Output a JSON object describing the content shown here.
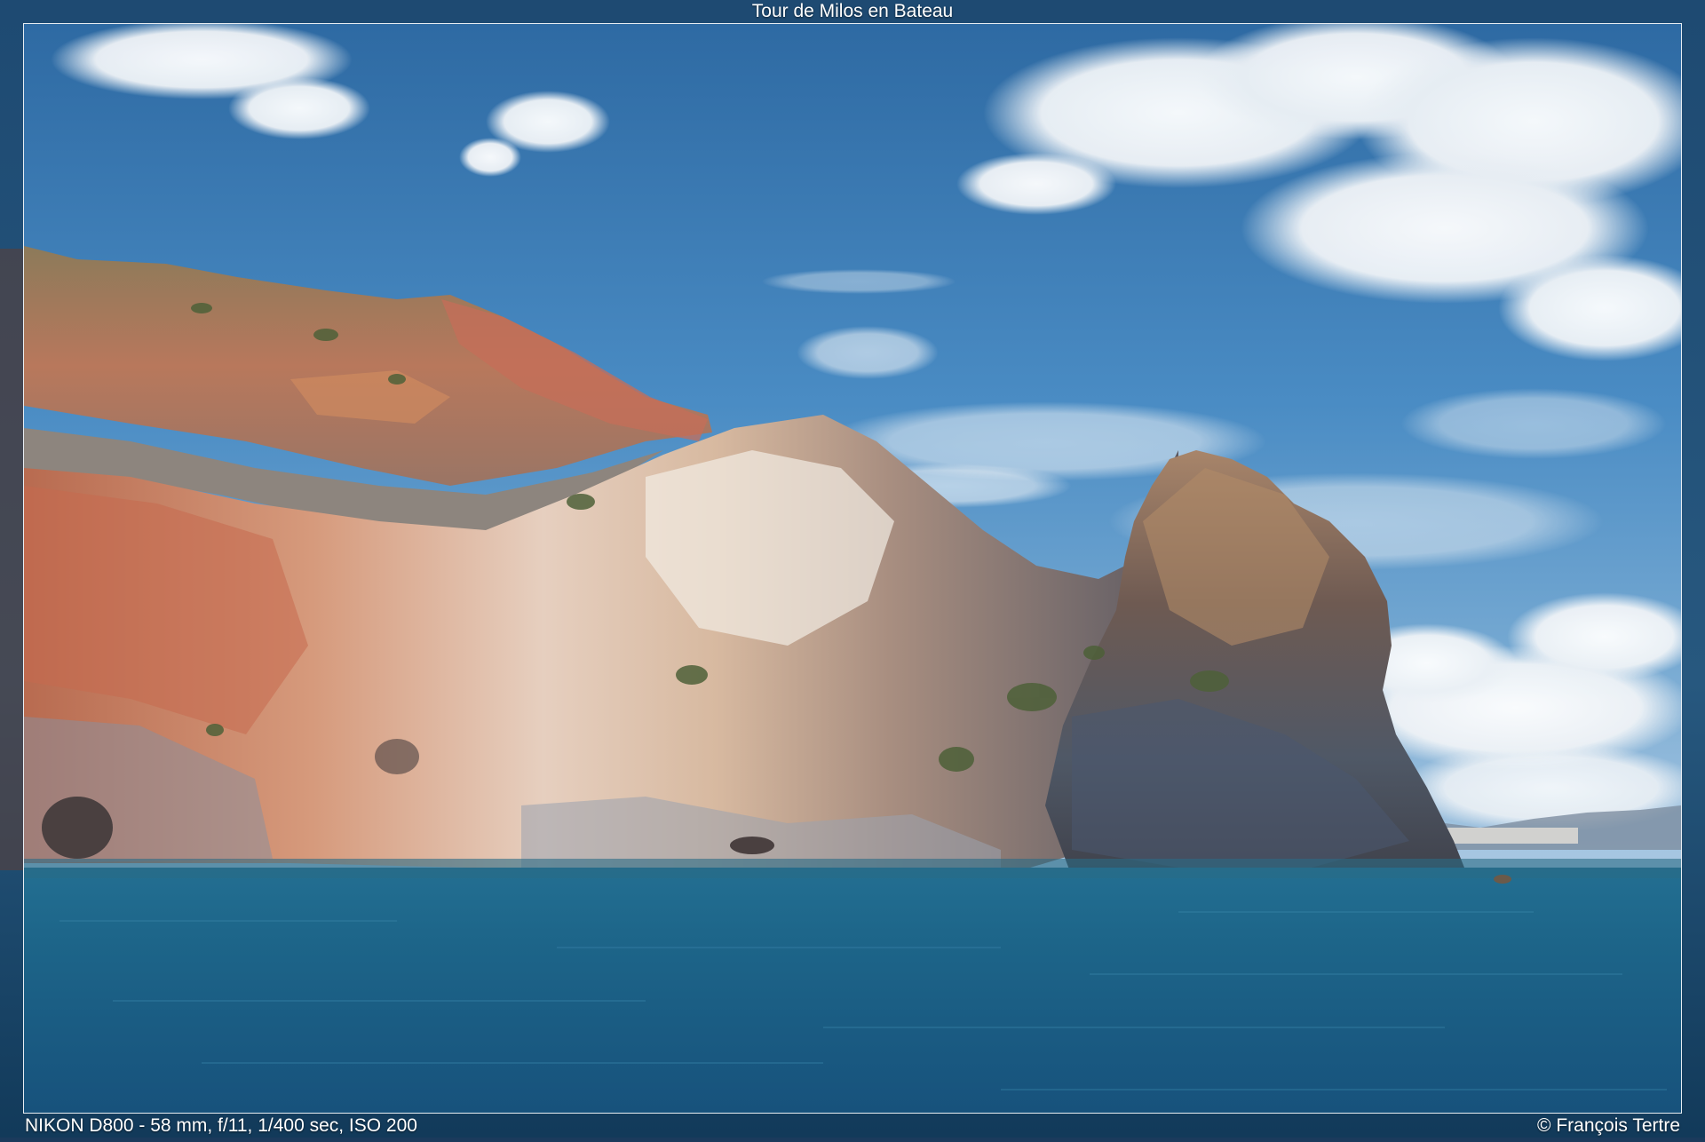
{
  "title": "Tour de Milos en Bateau",
  "exif": "NIKON D800 - 58 mm, f/11, 1/400 sec, ISO 200",
  "copyright": "© François Tertre",
  "colors": {
    "sky_top": "#2f6fa6",
    "sky_bottom": "#6ea6d3",
    "sea_top": "#1f6e96",
    "sea_bottom": "#17507a",
    "frame": "#1b3a5c",
    "border": "#e8edf2"
  }
}
